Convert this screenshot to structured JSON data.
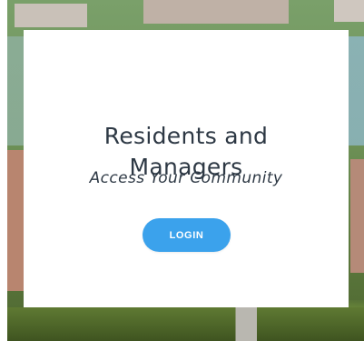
{
  "card": {
    "title_line1": "Residents and",
    "title_line2": "Managers",
    "subtitle": "Access Your Community",
    "login_label": "LOGIN"
  },
  "colors": {
    "title_text": "#2d3844",
    "button_bg": "#3ba2ec",
    "button_text": "#ffffff"
  }
}
